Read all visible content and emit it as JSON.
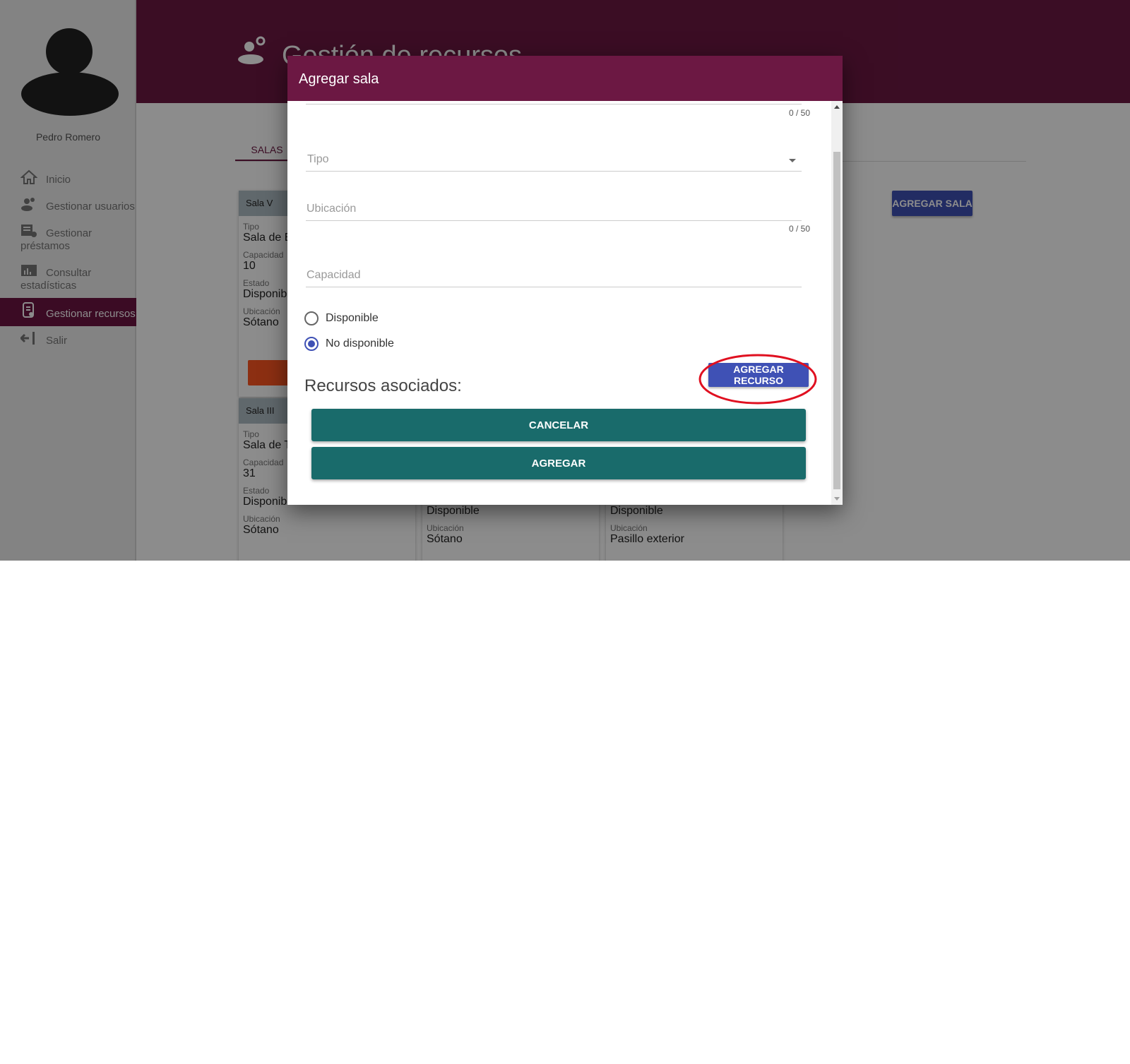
{
  "sidebar": {
    "user_name": "Pedro Romero",
    "items": [
      {
        "label": "Inicio",
        "icon": "home-icon"
      },
      {
        "label": "Gestionar usuarios",
        "icon": "users-icon"
      },
      {
        "label": "Gestionar préstamos",
        "icon": "loans-icon"
      },
      {
        "label": "Consultar estadísticas",
        "icon": "stats-icon"
      },
      {
        "label": "Gestionar recursos",
        "icon": "resources-icon",
        "active": true
      },
      {
        "label": "Salir",
        "icon": "logout-icon"
      }
    ]
  },
  "header": {
    "title": "Gestión de recursos"
  },
  "main": {
    "tab_salas": "SALAS",
    "add_room_button": "AGREGAR SALA",
    "cards": [
      {
        "title": "Sala V",
        "tipo_label": "Tipo",
        "tipo": "Sala de E",
        "capacidad_label": "Capacidad",
        "capacidad": "10",
        "estado_label": "Estado",
        "estado": "Disponib",
        "ubicacion_label": "Ubicación",
        "ubicacion": "Sótano"
      },
      {
        "title": "Sala III",
        "tipo_label": "Tipo",
        "tipo": "Sala de T",
        "capacidad_label": "Capacidad",
        "capacidad": "31",
        "estado_label": "Estado",
        "estado": "Disponible",
        "ubicacion_label": "Ubicación",
        "ubicacion": "Sótano"
      },
      {
        "estado": "Disponible",
        "ubicacion_label": "Ubicación",
        "ubicacion": "Sótano"
      },
      {
        "estado": "Disponible",
        "ubicacion_label": "Ubicación",
        "ubicacion": "Pasillo exterior"
      }
    ]
  },
  "dialog": {
    "title": "Agregar sala",
    "name_counter": "0 / 50",
    "tipo_placeholder": "Tipo",
    "ubicacion_placeholder": "Ubicación",
    "ubicacion_counter": "0 / 50",
    "capacidad_placeholder": "Capacidad",
    "radio_disponible": "Disponible",
    "radio_no_disponible": "No disponible",
    "selected_status": "No disponible",
    "recursos_title": "Recursos asociados:",
    "add_resource_button": "AGREGAR RECURSO",
    "cancel_button": "CANCELAR",
    "add_button": "AGREGAR"
  },
  "colors": {
    "brand": "#6c1843",
    "primary": "#3f51b5",
    "teal_button": "#196b6b",
    "highlight": "#e01020"
  }
}
